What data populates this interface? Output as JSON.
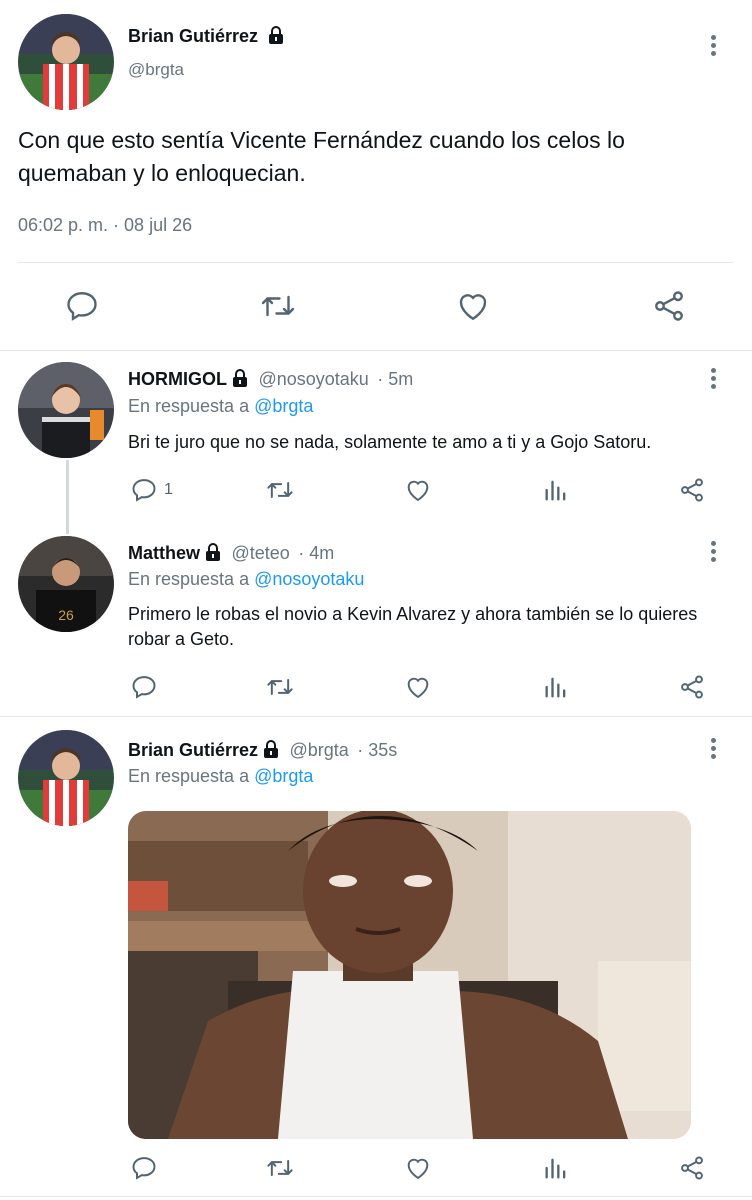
{
  "main_tweet": {
    "name": "Brian Gutiérrez",
    "handle": "@brgta",
    "text": "Con que esto sentía Vicente Fernández cuando los celos lo quemaban y lo enloquecian.",
    "timestamp": "06:02 p. m. · 08 jul 26",
    "actions": [
      "reply-icon",
      "retweet-icon",
      "like-icon",
      "share-icon"
    ]
  },
  "replies": [
    {
      "name": "HORMIGOL",
      "handle": "@nosoyotaku",
      "time": "· 5m",
      "reply_prefix": "En respuesta a ",
      "reply_to": "@brgta",
      "text": "Bri te juro que no se nada, solamente te amo a ti y a Gojo Satoru.",
      "reply_count": "1"
    },
    {
      "name": "Matthew",
      "handle": "@teteo",
      "time": "· 4m",
      "reply_prefix": "En respuesta a ",
      "reply_to": "@nosoyotaku",
      "text": "Primero le robas el novio a Kevin Alvarez y ahora también se lo quieres robar a Geto.",
      "reply_count": ""
    },
    {
      "name": "Brian Gutiérrez",
      "handle": "@brgta",
      "time": "· 35s",
      "reply_prefix": "En respuesta a ",
      "reply_to": "@brgta",
      "text": "",
      "reply_count": ""
    }
  ],
  "colors": {
    "text": "#0f1419",
    "muted": "#67757f",
    "link": "#1d9bf0",
    "divider": "#e1e6ea"
  }
}
